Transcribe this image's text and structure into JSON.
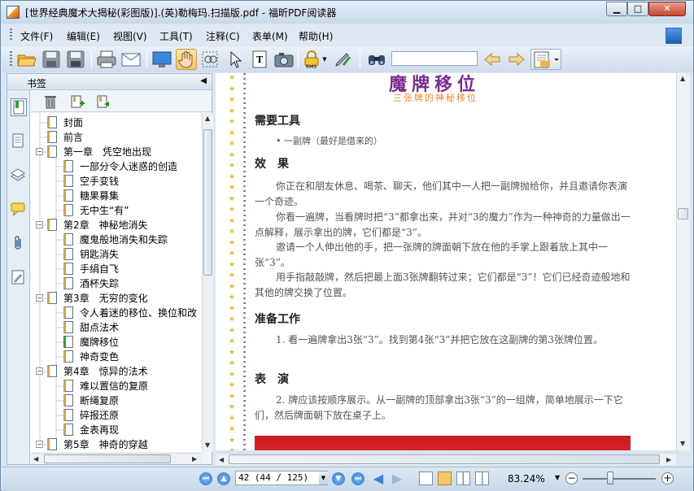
{
  "window": {
    "title": "[世界经典魔术大揭秘(彩图版)].(英)勒梅玛.扫描版.pdf - 福昕PDF阅读器"
  },
  "menus": [
    "文件(F)",
    "编辑(E)",
    "视图(V)",
    "工具(T)",
    "注释(C)",
    "表单(M)",
    "帮助(H)"
  ],
  "bookmarks": {
    "title": "书签",
    "items": [
      {
        "label": "封面"
      },
      {
        "label": "前言"
      },
      {
        "label": "第一章　凭空地出现"
      },
      {
        "label": "一部分令人迷惑的创造"
      },
      {
        "label": "空手变钱"
      },
      {
        "label": "糖果募集"
      },
      {
        "label": "无中生“有”"
      },
      {
        "label": "第2章　神秘地消失"
      },
      {
        "label": "魔鬼般地消失和失踪"
      },
      {
        "label": "钥匙消失"
      },
      {
        "label": "手绢自飞"
      },
      {
        "label": "酒杯失踪"
      },
      {
        "label": "第3章　无穷的变化"
      },
      {
        "label": "令人着迷的移位、换位和改"
      },
      {
        "label": "甜点法术"
      },
      {
        "label": "魔牌移位"
      },
      {
        "label": "神奇变色"
      },
      {
        "label": "第4章　惊异的法术"
      },
      {
        "label": "难以置信的复原"
      },
      {
        "label": "断绳复原"
      },
      {
        "label": "碎报还原"
      },
      {
        "label": "金表再现"
      },
      {
        "label": "第5章　神奇的穿越"
      }
    ]
  },
  "document": {
    "title": "魔牌移位",
    "subtitle": "三张牌的神秘移位",
    "h_tools": "需要工具",
    "tool_item": "• 一副牌（最好是借来的）",
    "h_effect": "效　果",
    "p1": "你正在和朋友休息、喝茶、聊天，他们其中一人把一副牌抛给你，并且邀请你表演一个奇迹。",
    "p2": "你看一遍牌，当看牌时把“3”都拿出来，并对“3的魔力”作为一种神奇的力量做出一点解释，展示拿出的牌，它们都是“3”。",
    "p3": "邀请一个人伸出他的手，把一张牌的牌面朝下放在他的手掌上跟着放上其中一张“3”。",
    "p4": "用手指敲敲牌，然后把最上面3张牌翻转过来；它们都是“3”！它们已经奇迹般地和其他的牌交换了位置。",
    "h_prep": "准备工作",
    "p5": "1. 看一遍牌拿出3张“3”。找到第4张“3”并把它放在这副牌的第3张牌位置。",
    "h_perform": "表　演",
    "p6": "2. 牌应该按顺序展示。从一副牌的顶部拿出3张“3”的一组牌，简单地展示一下它们，然后牌面朝下放在桌子上。"
  },
  "status": {
    "page_field": "42 (44 / 125)",
    "zoom": "83.24%"
  },
  "colors": {
    "title_purple": "#7b2c8e",
    "subtitle_orange": "#e08a2a",
    "accent_blue": "#2b74c8"
  }
}
